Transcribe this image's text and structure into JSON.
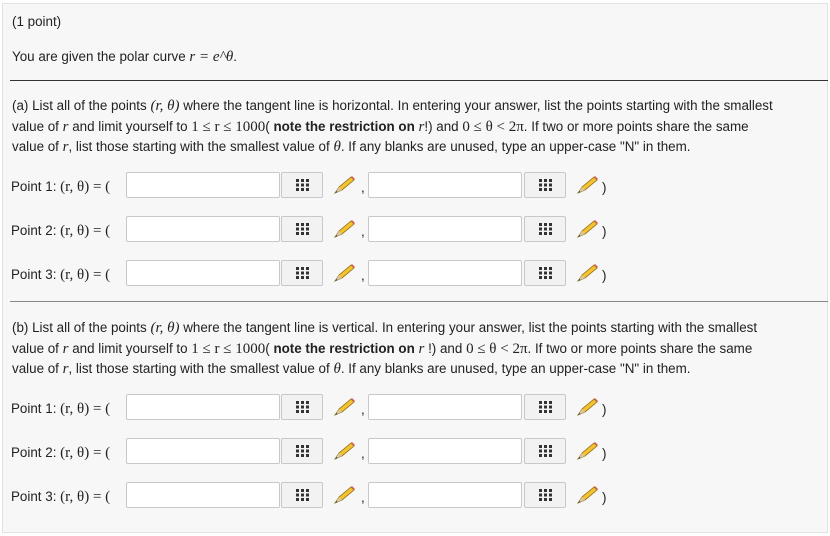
{
  "problem": {
    "points_label": "(1 point)",
    "intro_text": "You are given the polar curve ",
    "intro_eq": "r = e^θ"
  },
  "part_a": {
    "text1_prefix": "(a) List all of the points ",
    "text1_math": "(r, θ)",
    "text1_suffix": " where the tangent line is horizontal. In entering your answer, list the points starting with the smallest",
    "text2_prefix": "value of ",
    "text2_mid": " and limit yourself to ",
    "text2_bold": "note the restriction on ",
    "text2_suffix": " and ",
    "text2_end": ". If two or more points share the same",
    "text3_prefix": "value of ",
    "text3_mid": ", list those starting with the smallest value of ",
    "text3_suffix": ". If any blanks are unused, type an upper-case \"N\" in them.",
    "points": [
      {
        "label": "Point 1: ",
        "math": "(r, θ) = (",
        "r_value": "",
        "theta_value": ""
      },
      {
        "label": "Point 2: ",
        "math": "(r, θ) = (",
        "r_value": "",
        "theta_value": ""
      },
      {
        "label": "Point 3: ",
        "math": "(r, θ) = (",
        "r_value": "",
        "theta_value": ""
      }
    ]
  },
  "part_b": {
    "text1_prefix": "(b) List all of the points ",
    "text1_math": "(r, θ)",
    "text1_suffix": " where the tangent line is vertical. In entering your answer, list the points starting with the smallest",
    "text2_prefix": "value of ",
    "text2_mid": " and limit yourself to ",
    "text2_bold": "note the restriction on ",
    "text2_suffix": " and ",
    "text2_end": ". If two or more points share the same",
    "text3_prefix": "value of ",
    "text3_mid": ", list those starting with the smallest value of ",
    "text3_suffix": ". If any blanks are unused, type an upper-case \"N\" in them.",
    "points": [
      {
        "label": "Point 1: ",
        "math": "(r, θ) = (",
        "r_value": "",
        "theta_value": ""
      },
      {
        "label": "Point 2: ",
        "math": "(r, θ) = (",
        "r_value": "",
        "theta_value": ""
      },
      {
        "label": "Point 3: ",
        "math": "(r, θ) = (",
        "r_value": "",
        "theta_value": ""
      }
    ]
  },
  "math": {
    "r": "r",
    "theta": "θ",
    "r_range": "1 ≤ r ≤ 1000",
    "theta_range": "0 ≤ θ < 2π",
    "open_paren": "( ",
    "close_excl": "!)",
    "close_excl_space": " !)",
    "dot": "."
  },
  "ui": {
    "comma": ",",
    "close_paren": ")",
    "icons": {
      "grid": "matrix-grid-icon",
      "pencil": "pencil-edit-icon"
    }
  }
}
